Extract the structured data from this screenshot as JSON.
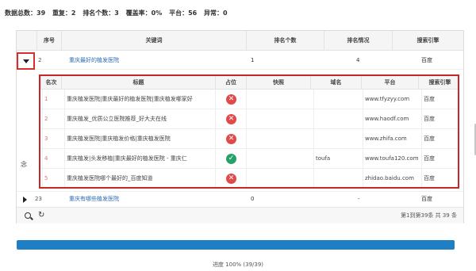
{
  "stats": {
    "total": "数据总数：39",
    "dup": "重复：2",
    "rank_count": "排名个数：3",
    "coverage": "覆盖率：0%",
    "platform": "平台：56",
    "error": "异常：0"
  },
  "table": {
    "headers": [
      "序号",
      "关键词",
      "排名个数",
      "排名情况",
      "搜索引擎"
    ],
    "row1": {
      "index": "2",
      "keyword": "重庆最好的植发医院",
      "rank_count": "1",
      "rank_status": "4",
      "engine": "百度"
    },
    "row2": {
      "index": "23",
      "keyword": "重庆有哪些植发医院",
      "rank_count": "0",
      "rank_status": "-",
      "engine": "百度"
    }
  },
  "inner": {
    "headers": [
      "名次",
      "标题",
      "占位",
      "快照",
      "域名",
      "平台",
      "搜索引擎"
    ],
    "rows": [
      {
        "rank": "1",
        "title": "重庆植发医院|重庆最好的植发医院|重庆植发哪家好",
        "status": "x",
        "snapshot": "",
        "domain": "",
        "platform": "www.tfyzyy.com",
        "engine": "百度"
      },
      {
        "rank": "2",
        "title": "重庆植发_优质公立医院推荐_好大夫在线",
        "status": "x",
        "snapshot": "",
        "domain": "",
        "platform": "www.haodf.com",
        "engine": "百度"
      },
      {
        "rank": "3",
        "title": "重庆植发医院|重庆植发价格|重庆植发医院",
        "status": "x",
        "snapshot": "",
        "domain": "",
        "platform": "www.zhifa.com",
        "engine": "百度"
      },
      {
        "rank": "4",
        "title": "重庆植发|头发移植|重庆最好的植发医院 - 重庆仁",
        "status": "check",
        "snapshot": "",
        "domain": "toufa",
        "platform": "www.toufa120.com",
        "engine": "百度"
      },
      {
        "rank": "5",
        "title": "重庆植发医院哪个最好的_百度知道",
        "status": "x",
        "snapshot": "",
        "domain": "",
        "platform": "zhidao.baidu.com",
        "engine": "百度"
      }
    ]
  },
  "side_char": "念",
  "pagination": "第1到第39条  共 39 条",
  "progress": {
    "fraction": 1.0,
    "label": "进度 100% (39/39)"
  },
  "icons": {
    "x": "✕",
    "check": "✓",
    "refresh": "↻"
  }
}
